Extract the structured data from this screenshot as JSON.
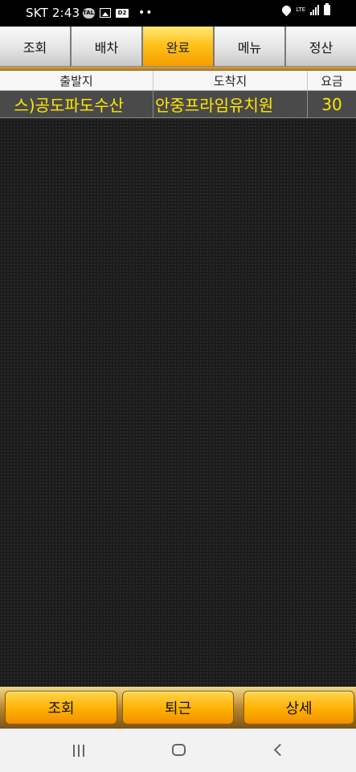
{
  "status_bar": {
    "time": "SKT 2:43",
    "network": "LTE"
  },
  "tabs": [
    {
      "label": "조회"
    },
    {
      "label": "배차"
    },
    {
      "label": "완료"
    },
    {
      "label": "메뉴"
    },
    {
      "label": "정산"
    }
  ],
  "active_tab": "완료",
  "table": {
    "headers": [
      "출발지",
      "도착지",
      "요금"
    ],
    "rows": [
      {
        "departure": "스)공도파도수산",
        "destination": "안중프라임유치원",
        "fare": "30"
      }
    ]
  },
  "actions": {
    "lookup_label": "조회",
    "leave_label": "퇴근",
    "detail_label": "상세"
  },
  "colors": {
    "accent": "#ffb000",
    "row_text": "#ffe800",
    "background": "#1b1b1b"
  },
  "icons": [
    "chat-icon",
    "image-icon",
    "d2-icon",
    "location-icon",
    "signal-icon",
    "battery-icon",
    "recent-apps-icon",
    "home-icon",
    "back-icon"
  ]
}
